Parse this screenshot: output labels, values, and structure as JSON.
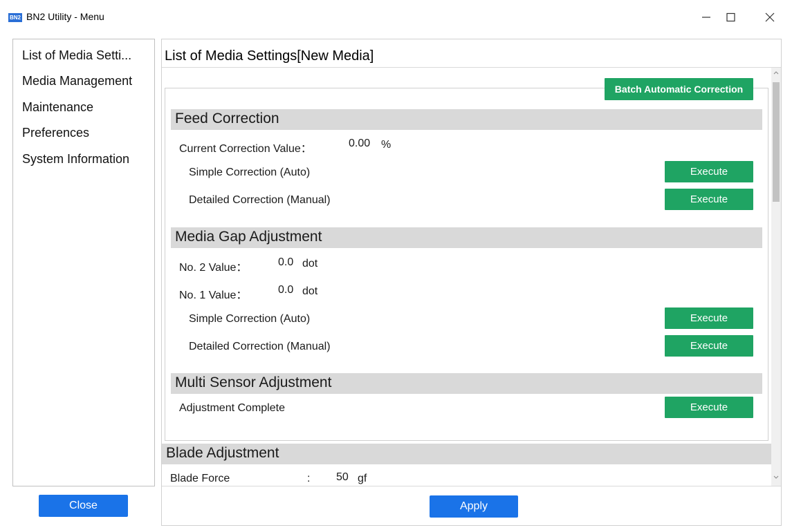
{
  "window": {
    "logo_text": "BN2",
    "title": "BN2 Utility - Menu"
  },
  "sidebar": {
    "items": [
      {
        "label": "List of Media Setti..."
      },
      {
        "label": "Media Management"
      },
      {
        "label": "Maintenance"
      },
      {
        "label": "Preferences"
      },
      {
        "label": "System Information"
      }
    ],
    "close_label": "Close"
  },
  "main": {
    "title": "List of Media Settings[New Media]",
    "batch_label": "Batch Automatic Correction",
    "feed_correction": {
      "heading": "Feed Correction",
      "current_label": "Current Correction Value：",
      "current_value": "0.00",
      "current_unit": "%",
      "simple_label": "Simple Correction (Auto)",
      "detailed_label": "Detailed Correction (Manual)"
    },
    "media_gap": {
      "heading": "Media Gap Adjustment",
      "no2_label": "No. 2 Value：",
      "no2_value": "0.0",
      "no2_unit": "dot",
      "no1_label": "No. 1 Value：",
      "no1_value": "0.0",
      "no1_unit": "dot",
      "simple_label": "Simple Correction (Auto)",
      "detailed_label": "Detailed Correction (Manual)"
    },
    "multi_sensor": {
      "heading": "Multi Sensor Adjustment",
      "status_label": "Adjustment Complete"
    },
    "blade": {
      "heading": "Blade Adjustment",
      "force_label": "Blade Force",
      "force_colon": ":",
      "force_value": "50",
      "force_unit": "gf"
    },
    "execute_label": "Execute",
    "apply_label": "Apply"
  },
  "colors": {
    "accent_blue": "#1a73e8",
    "execute_green": "#1fa463",
    "section_gray": "#d9d9d9"
  }
}
